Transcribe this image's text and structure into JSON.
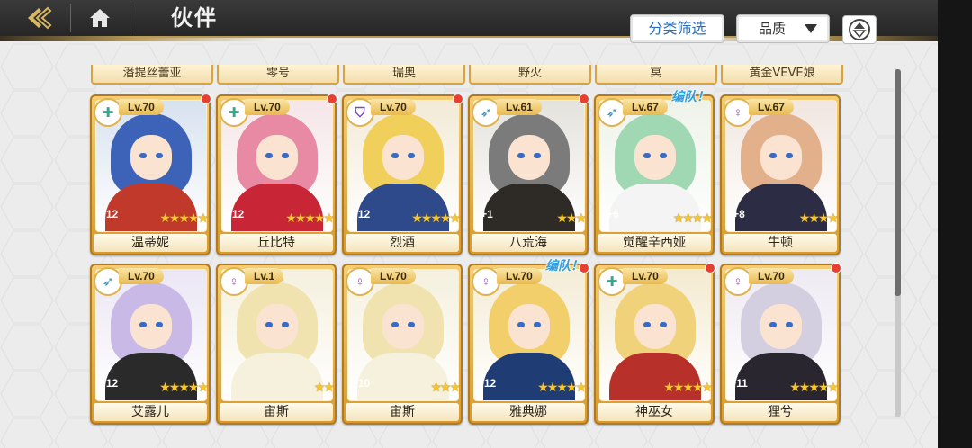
{
  "header": {
    "title": "伙伴"
  },
  "toolbar": {
    "filter_label": "分类筛选",
    "quality_label": "品质"
  },
  "top_row_names": [
    "潘提丝蕾亚",
    "零号",
    "瑞奥",
    "野火",
    "冥",
    "黄金VEVE娘"
  ],
  "cards": [
    {
      "name": "温蒂妮",
      "level": "Lv.70",
      "plus": "+12",
      "stars": 5,
      "class_icon": "heal-cross-icon",
      "badge_color": "#2faa8a",
      "team": "",
      "dot": true,
      "hair": "#3d63b8",
      "outfit": "#c0392b",
      "bg": "#d7e2f0"
    },
    {
      "name": "丘比特",
      "level": "Lv.70",
      "plus": "+12",
      "stars": 5,
      "class_icon": "heal-cross-icon",
      "badge_color": "#2faa8a",
      "team": "",
      "dot": true,
      "hair": "#e88aa3",
      "outfit": "#c82636",
      "bg": "#f5e6e8"
    },
    {
      "name": "烈酒",
      "level": "Lv.70",
      "plus": "+12",
      "stars": 5,
      "class_icon": "shield-icon",
      "badge_color": "#7a4fb5",
      "team": "",
      "dot": true,
      "hair": "#f0cf5a",
      "outfit": "#2e4a8a",
      "bg": "#f3ead6"
    },
    {
      "name": "八荒海",
      "level": "Lv.61",
      "plus": "+1",
      "stars": 3,
      "class_icon": "bow-icon",
      "badge_color": "#2b8ec4",
      "team": "",
      "dot": true,
      "hair": "#7b7b7b",
      "outfit": "#2e2a26",
      "bg": "#e4e2dc"
    },
    {
      "name": "觉醒辛西娅",
      "level": "Lv.67",
      "plus": "+6",
      "stars": 4,
      "class_icon": "bow-icon",
      "badge_color": "#2b8ec4",
      "team": "编队！",
      "dot": false,
      "hair": "#9fd8b2",
      "outfit": "#f4f4f4",
      "bg": "#eef3ea"
    },
    {
      "name": "牛顿",
      "level": "Lv.67",
      "plus": "+8",
      "stars": 4,
      "class_icon": "female-icon",
      "badge_color": "#9b4fb5",
      "team": "",
      "dot": false,
      "hair": "#e3b08c",
      "outfit": "#2c2c44",
      "bg": "#f1e6e0"
    },
    {
      "name": "艾露儿",
      "level": "Lv.70",
      "plus": "+12",
      "stars": 5,
      "class_icon": "bow-icon",
      "badge_color": "#2b8ec4",
      "team": "",
      "dot": false,
      "hair": "#c8b9e6",
      "outfit": "#2a2a2a",
      "bg": "#ebe6f4"
    },
    {
      "name": "宙斯",
      "level": "Lv.1",
      "plus": "",
      "stars": 2,
      "class_icon": "female-icon",
      "badge_color": "#9b4fb5",
      "team": "",
      "dot": false,
      "hair": "#f1e3b0",
      "outfit": "#f6f1dc",
      "bg": "#f5f0de"
    },
    {
      "name": "宙斯",
      "level": "Lv.70",
      "plus": "+10",
      "stars": 3,
      "class_icon": "female-icon",
      "badge_color": "#9b4fb5",
      "team": "",
      "dot": false,
      "hair": "#f1e3b0",
      "outfit": "#f6f1dc",
      "bg": "#f5f0de"
    },
    {
      "name": "雅典娜",
      "level": "Lv.70",
      "plus": "+12",
      "stars": 5,
      "class_icon": "female-icon",
      "badge_color": "#9b4fb5",
      "team": "编队！",
      "dot": true,
      "hair": "#f2cf6a",
      "outfit": "#1f3c74",
      "bg": "#f4ecd6"
    },
    {
      "name": "神巫女",
      "level": "Lv.70",
      "plus": "",
      "stars": 5,
      "class_icon": "heal-cross-icon",
      "badge_color": "#2faa8a",
      "team": "",
      "dot": true,
      "hair": "#f0d27a",
      "outfit": "#b8302a",
      "bg": "#f4ead0"
    },
    {
      "name": "狸兮",
      "level": "Lv.70",
      "plus": "+11",
      "stars": 5,
      "class_icon": "female-icon",
      "badge_color": "#9b4fb5",
      "team": "",
      "dot": true,
      "hair": "#d4cfe0",
      "outfit": "#2a2630",
      "bg": "#eeeaf2"
    }
  ]
}
